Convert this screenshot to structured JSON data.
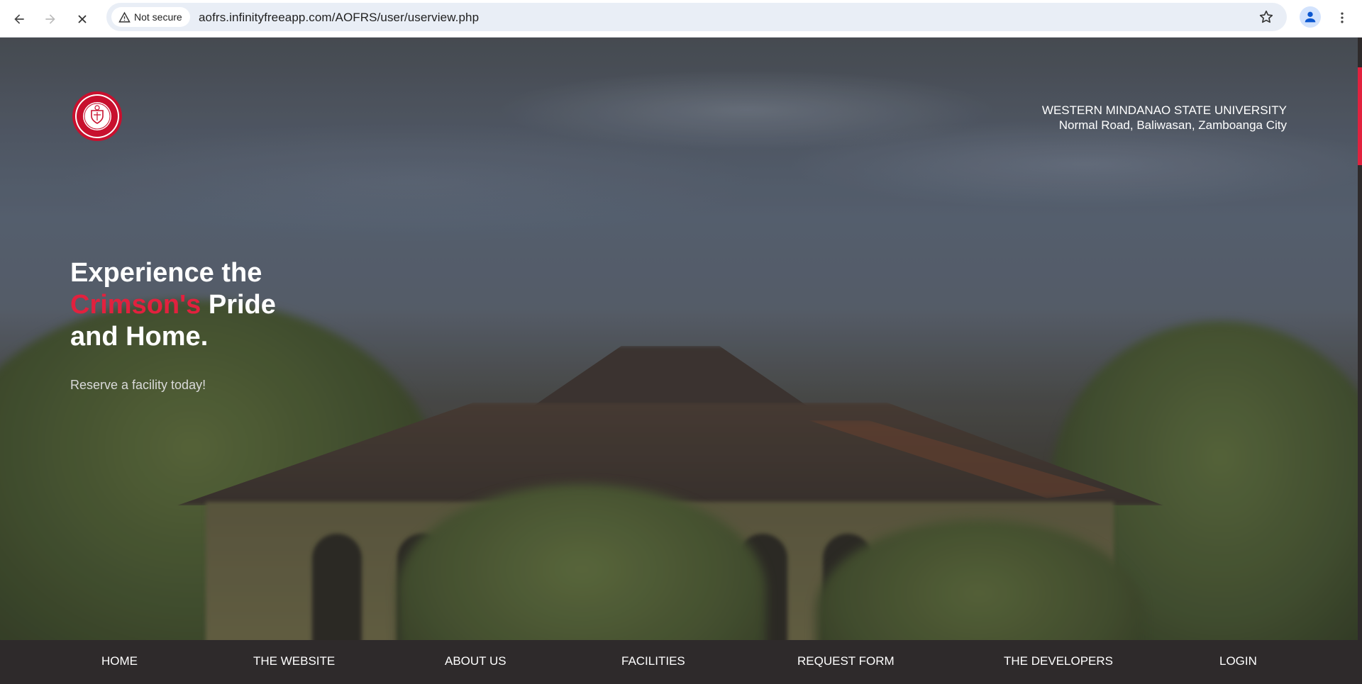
{
  "browser": {
    "security_label": "Not secure",
    "url": "aofrs.infinityfreeapp.com/AOFRS/user/userview.php",
    "icons": {
      "back": "back-arrow-icon",
      "forward": "forward-arrow-icon",
      "stop": "stop-loading-icon",
      "warning": "warning-icon",
      "bookmark": "star-icon",
      "profile": "profile-icon",
      "menu": "kebab-menu-icon"
    }
  },
  "header": {
    "university_name": "WESTERN MINDANAO STATE UNIVERSITY",
    "address": "Normal Road, Baliwasan, Zamboanga City"
  },
  "hero": {
    "headline_line1": "Experience the",
    "headline_highlight": "Crimson's",
    "headline_line2_rest": " Pride",
    "headline_line3": "and Home.",
    "subtext": "Reserve a facility today!"
  },
  "nav": {
    "items": [
      {
        "label": "HOME"
      },
      {
        "label": "THE WEBSITE"
      },
      {
        "label": "ABOUT US"
      },
      {
        "label": "FACILITIES"
      },
      {
        "label": "REQUEST FORM"
      },
      {
        "label": "THE DEVELOPERS"
      },
      {
        "label": "LOGIN"
      }
    ]
  },
  "colors": {
    "accent": "#e2213e",
    "nav_background": "#2e2a2b",
    "text": "#ffffff"
  }
}
